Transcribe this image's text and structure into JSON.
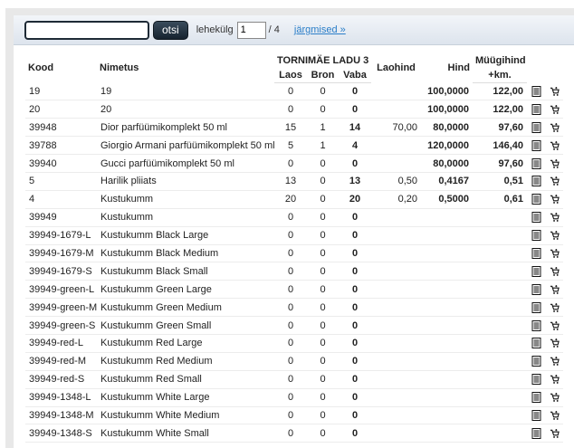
{
  "search": {
    "value": "",
    "button_label": "otsi"
  },
  "pagination": {
    "page_label": "lehekülg",
    "current_page": "1",
    "total": "/ 4",
    "next_label": "järgmised »"
  },
  "columns": {
    "code": "Kood",
    "name": "Nimetus",
    "warehouse": "TORNIMÄE LADU 3",
    "laos": "Laos",
    "bron": "Bron",
    "vaba": "Vaba",
    "cost": "Laohind",
    "price": "Hind",
    "sale_line1": "Müügihind",
    "sale_line2": "+km."
  },
  "rows": [
    {
      "code": "19",
      "name": "19",
      "laos": "0",
      "bron": "0",
      "vaba": "0",
      "cost": "",
      "price": "100,0000",
      "sale": "122,00"
    },
    {
      "code": "20",
      "name": "20",
      "laos": "0",
      "bron": "0",
      "vaba": "0",
      "cost": "",
      "price": "100,0000",
      "sale": "122,00"
    },
    {
      "code": "39948",
      "name": "Dior parfüümikomplekt 50 ml",
      "laos": "15",
      "bron": "1",
      "vaba": "14",
      "cost": "70,00",
      "price": "80,0000",
      "sale": "97,60"
    },
    {
      "code": "39788",
      "name": "Giorgio Armani parfüümikomplekt 50 ml",
      "laos": "5",
      "bron": "1",
      "vaba": "4",
      "cost": "",
      "price": "120,0000",
      "sale": "146,40"
    },
    {
      "code": "39940",
      "name": "Gucci parfüümikomplekt 50 ml",
      "laos": "0",
      "bron": "0",
      "vaba": "0",
      "cost": "",
      "price": "80,0000",
      "sale": "97,60"
    },
    {
      "code": "5",
      "name": "Harilik pliiats",
      "laos": "13",
      "bron": "0",
      "vaba": "13",
      "cost": "0,50",
      "price": "0,4167",
      "sale": "0,51"
    },
    {
      "code": "4",
      "name": "Kustukumm",
      "laos": "20",
      "bron": "0",
      "vaba": "20",
      "cost": "0,20",
      "price": "0,5000",
      "sale": "0,61"
    },
    {
      "code": "39949",
      "name": "Kustukumm",
      "laos": "0",
      "bron": "0",
      "vaba": "0",
      "cost": "",
      "price": "",
      "sale": ""
    },
    {
      "code": "39949-1679-L",
      "name": "Kustukumm Black Large",
      "laos": "0",
      "bron": "0",
      "vaba": "0",
      "cost": "",
      "price": "",
      "sale": ""
    },
    {
      "code": "39949-1679-M",
      "name": "Kustukumm Black Medium",
      "laos": "0",
      "bron": "0",
      "vaba": "0",
      "cost": "",
      "price": "",
      "sale": ""
    },
    {
      "code": "39949-1679-S",
      "name": "Kustukumm Black Small",
      "laos": "0",
      "bron": "0",
      "vaba": "0",
      "cost": "",
      "price": "",
      "sale": ""
    },
    {
      "code": "39949-green-L",
      "name": "Kustukumm Green Large",
      "laos": "0",
      "bron": "0",
      "vaba": "0",
      "cost": "",
      "price": "",
      "sale": ""
    },
    {
      "code": "39949-green-M",
      "name": "Kustukumm Green Medium",
      "laos": "0",
      "bron": "0",
      "vaba": "0",
      "cost": "",
      "price": "",
      "sale": ""
    },
    {
      "code": "39949-green-S",
      "name": "Kustukumm Green Small",
      "laos": "0",
      "bron": "0",
      "vaba": "0",
      "cost": "",
      "price": "",
      "sale": ""
    },
    {
      "code": "39949-red-L",
      "name": "Kustukumm Red Large",
      "laos": "0",
      "bron": "0",
      "vaba": "0",
      "cost": "",
      "price": "",
      "sale": ""
    },
    {
      "code": "39949-red-M",
      "name": "Kustukumm Red Medium",
      "laos": "0",
      "bron": "0",
      "vaba": "0",
      "cost": "",
      "price": "",
      "sale": ""
    },
    {
      "code": "39949-red-S",
      "name": "Kustukumm Red Small",
      "laos": "0",
      "bron": "0",
      "vaba": "0",
      "cost": "",
      "price": "",
      "sale": ""
    },
    {
      "code": "39949-1348-L",
      "name": "Kustukumm White Large",
      "laos": "0",
      "bron": "0",
      "vaba": "0",
      "cost": "",
      "price": "",
      "sale": ""
    },
    {
      "code": "39949-1348-M",
      "name": "Kustukumm White Medium",
      "laos": "0",
      "bron": "0",
      "vaba": "0",
      "cost": "",
      "price": "",
      "sale": ""
    },
    {
      "code": "39949-1348-S",
      "name": "Kustukumm White Small",
      "laos": "0",
      "bron": "0",
      "vaba": "0",
      "cost": "",
      "price": "",
      "sale": ""
    }
  ],
  "row_icons": [
    "document-icon",
    "add-to-cart-icon"
  ],
  "colors": {
    "link": "#2a7ec8",
    "button": "#1e2a35",
    "toolbar": "#dde4ed"
  }
}
